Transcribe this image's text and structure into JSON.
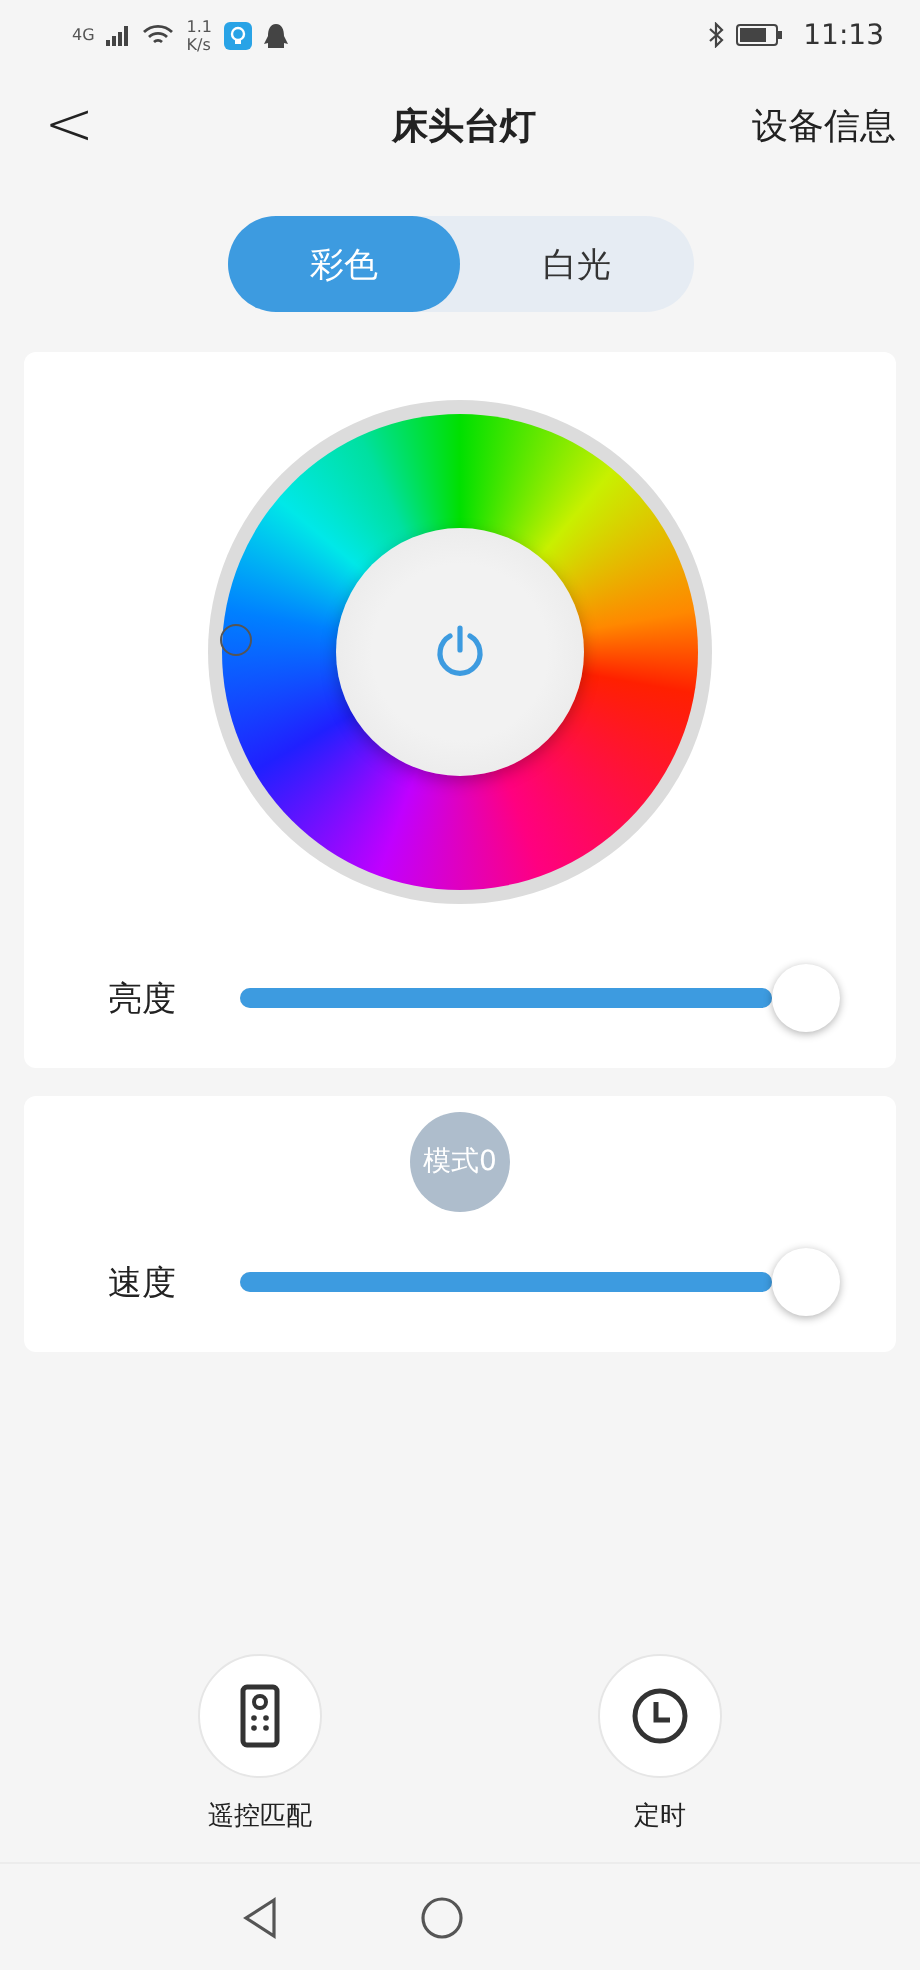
{
  "status_bar": {
    "network": "4G",
    "speed": "1.1",
    "speed_unit": "K/s",
    "time": "11:13"
  },
  "header": {
    "back": "<",
    "title": "床头台灯",
    "action": "设备信息"
  },
  "tabs": [
    {
      "label": "彩色",
      "selected": true
    },
    {
      "label": "白光",
      "selected": false
    }
  ],
  "color_card": {
    "power_on": true,
    "slider": {
      "label": "亮度",
      "level": 1.0
    }
  },
  "mode_card": {
    "mode": "模式0",
    "slider": {
      "label": "速度",
      "level": 1.0
    }
  },
  "actions": [
    {
      "kind": "remote",
      "label": "遥控匹配"
    },
    {
      "kind": "timer",
      "label": "定时"
    }
  ]
}
